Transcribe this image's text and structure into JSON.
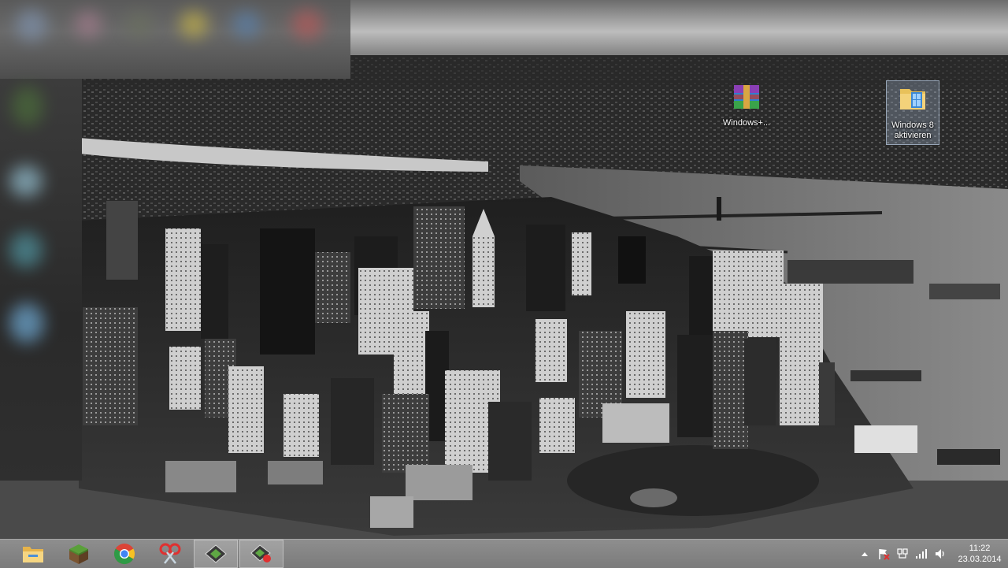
{
  "desktop": {
    "icons": [
      {
        "label": "Windows+...",
        "icon": "winrar-archive-icon"
      },
      {
        "label": "Windows 8 aktivieren",
        "icon": "folder-icon",
        "selected": true
      }
    ]
  },
  "taskbar": {
    "pinned": [
      {
        "name": "file-explorer",
        "icon": "folder-icon"
      },
      {
        "name": "minecraft",
        "icon": "grass-block-icon"
      },
      {
        "name": "chrome",
        "icon": "chrome-icon"
      },
      {
        "name": "snipping-tool",
        "icon": "scissors-icon"
      },
      {
        "name": "recorder-1",
        "icon": "screen-recorder-icon",
        "active": true
      },
      {
        "name": "recorder-2",
        "icon": "record-icon"
      }
    ],
    "tray": {
      "icons": [
        "show-hidden-icons-arrow",
        "action-center-flag-icon",
        "network-icon",
        "signal-bars-icon",
        "volume-icon"
      ],
      "time": "11:22",
      "date": "23.03.2014"
    }
  },
  "colors": {
    "taskbar": "#828282",
    "accent_red": "#e03030",
    "chrome_green": "#2e9b46",
    "chrome_yellow": "#f6c223",
    "chrome_red": "#db4437",
    "chrome_blue": "#4285f4"
  }
}
